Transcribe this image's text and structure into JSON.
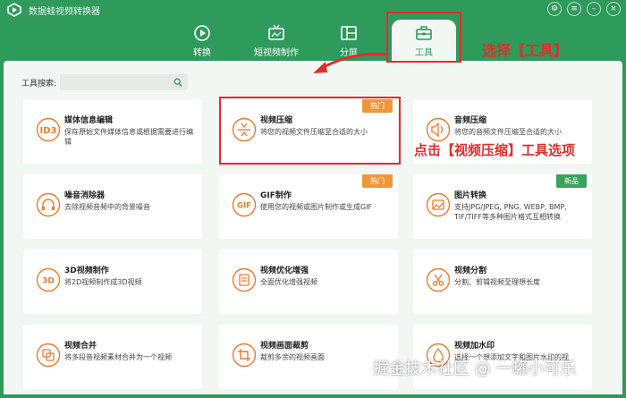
{
  "app": {
    "title": "数据蛙视频转换器"
  },
  "colors": {
    "brand": "#2e9a5c",
    "icon_orange": "#f07a2a",
    "annotation_red": "#e32d2d",
    "hot": "#f0963a",
    "new": "#37a35d"
  },
  "nav": {
    "tabs": [
      {
        "label": "转换",
        "icon": "convert-icon"
      },
      {
        "label": "短视频制作",
        "icon": "tv-icon"
      },
      {
        "label": "分屏",
        "icon": "split-screen-icon"
      },
      {
        "label": "工具",
        "icon": "toolbox-icon",
        "active": true
      }
    ]
  },
  "annotations": {
    "select_tools": "选择【工具】",
    "click_compress": "点击【视频压缩】工具选项"
  },
  "search": {
    "label": "工具搜索:",
    "placeholder": ""
  },
  "tools": [
    {
      "title": "媒体信息编辑",
      "desc": "保存原始文件媒体信息或根据需要进行编辑",
      "icon": "id3-icon",
      "icon_text": "ID3"
    },
    {
      "title": "视频压缩",
      "desc": "将您的视频文件压缩至合适的大小",
      "icon": "compress-icon",
      "badge": "热门"
    },
    {
      "title": "音频压缩",
      "desc": "将您的音频文件压缩至合适的大小",
      "icon": "audio-compress-icon"
    },
    {
      "title": "噪音消除器",
      "desc": "去除视频音频中的背景噪音",
      "icon": "headphone-icon"
    },
    {
      "title": "GIF制作",
      "desc": "使用您的视频或图片制作或生成GIF",
      "icon": "gif-icon",
      "icon_text": "GIF",
      "badge": "热门"
    },
    {
      "title": "图片转换",
      "desc": "支持JPG/JPEG, PNG, WEBP, BMP, TIF/TIFF等多种图片格式互相转换",
      "icon": "image-convert-icon",
      "badge": "新品"
    },
    {
      "title": "3D视频制作",
      "desc": "将2D视频制作成3D视频",
      "icon": "3d-icon",
      "icon_text": "3D"
    },
    {
      "title": "视频优化增强",
      "desc": "全面优化增强视频",
      "icon": "enhance-icon"
    },
    {
      "title": "视频分割",
      "desc": "分割、剪辑视频至理想长度",
      "icon": "scissors-icon"
    },
    {
      "title": "视频合并",
      "desc": "将多段音视频素材合并为一个视频",
      "icon": "merge-icon"
    },
    {
      "title": "视频画面裁剪",
      "desc": "裁剪多余的视频画面",
      "icon": "crop-icon"
    },
    {
      "title": "视频加水印",
      "desc": "选择一个想添加文字和图片水印的视",
      "icon": "watermark-drop-icon"
    }
  ],
  "watermark": "掘金技术社区 @ 一罐小可乐"
}
